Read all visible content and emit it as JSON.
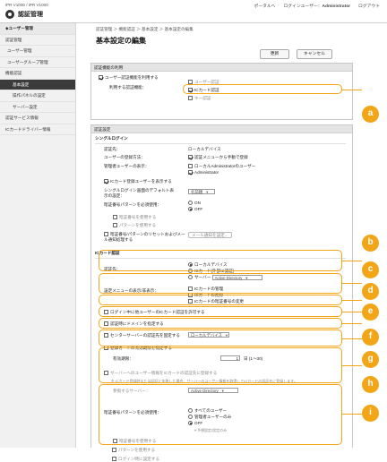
{
  "header": {
    "device": "iPR V1000 / iPR V1000",
    "app_title": "認証管理",
    "portal": "ポータルへ",
    "user_label": "ログインユーザー：",
    "user_name": "Administrator",
    "logout": "ログアウト"
  },
  "sidebar": {
    "back": "◆ユーザー管理",
    "items": [
      "認証管理",
      "ユーザー管理",
      "ユーザーグループ管理",
      "機能認証",
      "基本設定",
      "操作パネルの設定",
      "サーバー設定",
      "認証サービス情報",
      "ICカードドライバー情報"
    ]
  },
  "breadcrumb": "認証管理 ＞ 機能認証 ＞ 基本設定 ＞ 基本設定の編集",
  "page_title": "基本設定の編集",
  "buttons": {
    "update": "更新",
    "cancel": "キャンセル"
  },
  "section1": {
    "title": "認証機能の利用",
    "use_auth": "ユーザー認証機能を利用する",
    "methods_label": "利用する認証機能：",
    "m1": "ユーザー認証",
    "m2": "ICカード認証",
    "m3": "キー認証"
  },
  "section2": {
    "title": "認証設定",
    "subhead": "シングルログイン",
    "rows": {
      "auth_dest": "認証先：",
      "auth_dest_val": "ローカルデバイス",
      "reg_method": "ユーザーの登録方法：",
      "reg_method_val": "認証メニューから手動で登録",
      "admin_display": "管理者ユーザーの表示：",
      "admin_val1": "ローカルAdministratorのユーザー",
      "admin_val2": "Administrator",
      "show_ic_users": "ICカード登録ユーザーを表示する",
      "default_screen": "シングルログイン画面のデフォルト表示の設定：",
      "default_screen_val": "名前順",
      "pin_required": "暗証番号パターンを必須使用：",
      "on": "ON",
      "off": "OFF",
      "use_pin": "暗証番号を使用する",
      "use_pattern": "パターンを使用する",
      "reset_notify": "暗証番号/パターンのリセットおよびメール通知処理する",
      "mail_btn": "メール通知を設定..."
    }
  },
  "ic": {
    "subhead": "ICカード認証",
    "auth_dest": "認証先：",
    "opt_local": "ローカルデバイス",
    "opt_ic": "ICカード(外部に認証)",
    "opt_server": "サーバー",
    "server_sel": "Active Directory",
    "menu_display": "設定メニューの表示/非表示：",
    "menu_opt1": "ICカードの管理",
    "menu_opt2": "ICカードの削除",
    "menu_opt3": "ICカードの暗証番号の変更",
    "login_ok": "ログイン中に他ユーザーのICカード認証を許可する",
    "domain_specify": "認証時にドメインを指定する",
    "center_fixed": "センターサーバーの認証先を固定する",
    "center_val": "ローカルデバイス",
    "expiry": "登録カードの有効期限を指定する",
    "period_label": "有効期限：",
    "period_val": "1",
    "period_unit": "日 (1〜30)",
    "server_ic": "サーバーへのユーザー情報をICカードの認証先に登録する",
    "note": "※ ICカード登録時または認証に失敗した場合、サーバーのユーザー情報を取得してICカードの認証先に登録します。",
    "ref_server": "参照するサーバー：",
    "ref_val": "Active Directory",
    "pin2": "暗証番号パターンを必須使用：",
    "r_all": "すべてのユーザー",
    "r_admin": "管理者ユーザーのみ",
    "r_off": "OFF",
    "r_note": "＊予想設定/設定のみ",
    "use_pin": "暗証番号を使用する",
    "use_pattern": "パターンを使用する",
    "login_set": "ログイン時に設定する"
  },
  "callouts": [
    "a",
    "b",
    "c",
    "d",
    "e",
    "f",
    "g",
    "h",
    "i"
  ],
  "colors": {
    "accent": "#f2a516",
    "active": "#3b3b3b"
  }
}
